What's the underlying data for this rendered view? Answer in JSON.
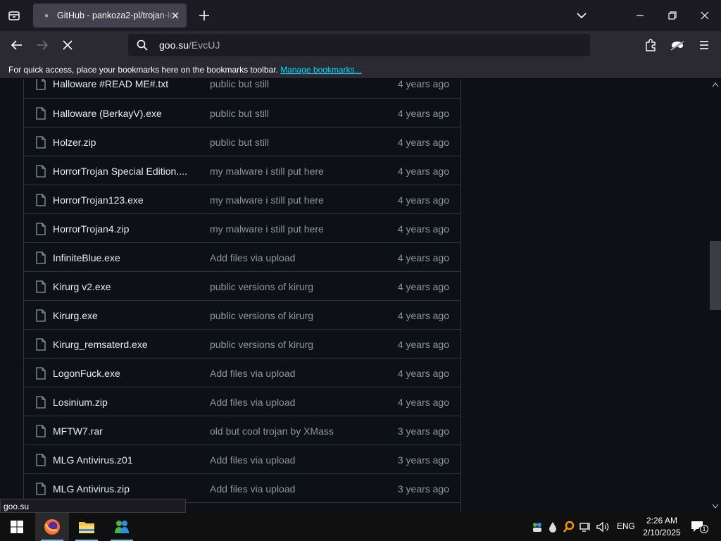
{
  "browser": {
    "tab_title": "GitHub - pankoza2-pl/trojan-le",
    "url_host": "goo.su",
    "url_path": "/EvcUJ",
    "status_text": "goo.su"
  },
  "bookmarks_bar": {
    "message": "For quick access, place your bookmarks here on the bookmarks toolbar.",
    "link": "Manage bookmarks..."
  },
  "files": [
    {
      "name": "Halloware #READ ME#.txt",
      "message": "public but still",
      "age": "4 years ago"
    },
    {
      "name": "Halloware (BerkayV).exe",
      "message": "public but still",
      "age": "4 years ago"
    },
    {
      "name": "Holzer.zip",
      "message": "public but still",
      "age": "4 years ago"
    },
    {
      "name": "HorrorTrojan Special Edition....",
      "message": "my malware i still put here",
      "age": "4 years ago"
    },
    {
      "name": "HorrorTrojan123.exe",
      "message": "my malware i still put here",
      "age": "4 years ago"
    },
    {
      "name": "HorrorTrojan4.zip",
      "message": "my malware i still put here",
      "age": "4 years ago"
    },
    {
      "name": "InfiniteBlue.exe",
      "message": "Add files via upload",
      "age": "4 years ago"
    },
    {
      "name": "Kirurg v2.exe",
      "message": "public versions of kirurg",
      "age": "4 years ago"
    },
    {
      "name": "Kirurg.exe",
      "message": "public versions of kirurg",
      "age": "4 years ago"
    },
    {
      "name": "Kirurg_remsaterd.exe",
      "message": "public versions of kirurg",
      "age": "4 years ago"
    },
    {
      "name": "LogonFuck.exe",
      "message": "Add files via upload",
      "age": "4 years ago"
    },
    {
      "name": "Losinium.zip",
      "message": "Add files via upload",
      "age": "4 years ago"
    },
    {
      "name": "MFTW7.rar",
      "message": "old but cool trojan by XMass",
      "age": "3 years ago"
    },
    {
      "name": "MLG Antivirus.z01",
      "message": "Add files via upload",
      "age": "3 years ago"
    },
    {
      "name": "MLG Antivirus.zip",
      "message": "Add files via upload",
      "age": "3 years ago"
    }
  ],
  "taskbar": {
    "apps": [
      "start-button",
      "firefox-icon",
      "file-explorer-icon",
      "messenger-icon"
    ],
    "language": "ENG",
    "time": "2:26 AM",
    "date": "2/10/2025",
    "notification_count": "1"
  },
  "colors": {
    "page_bg": "#0d1117",
    "link": "#00ddff",
    "text_primary": "#e6edf3",
    "text_muted": "#8d96a0"
  }
}
